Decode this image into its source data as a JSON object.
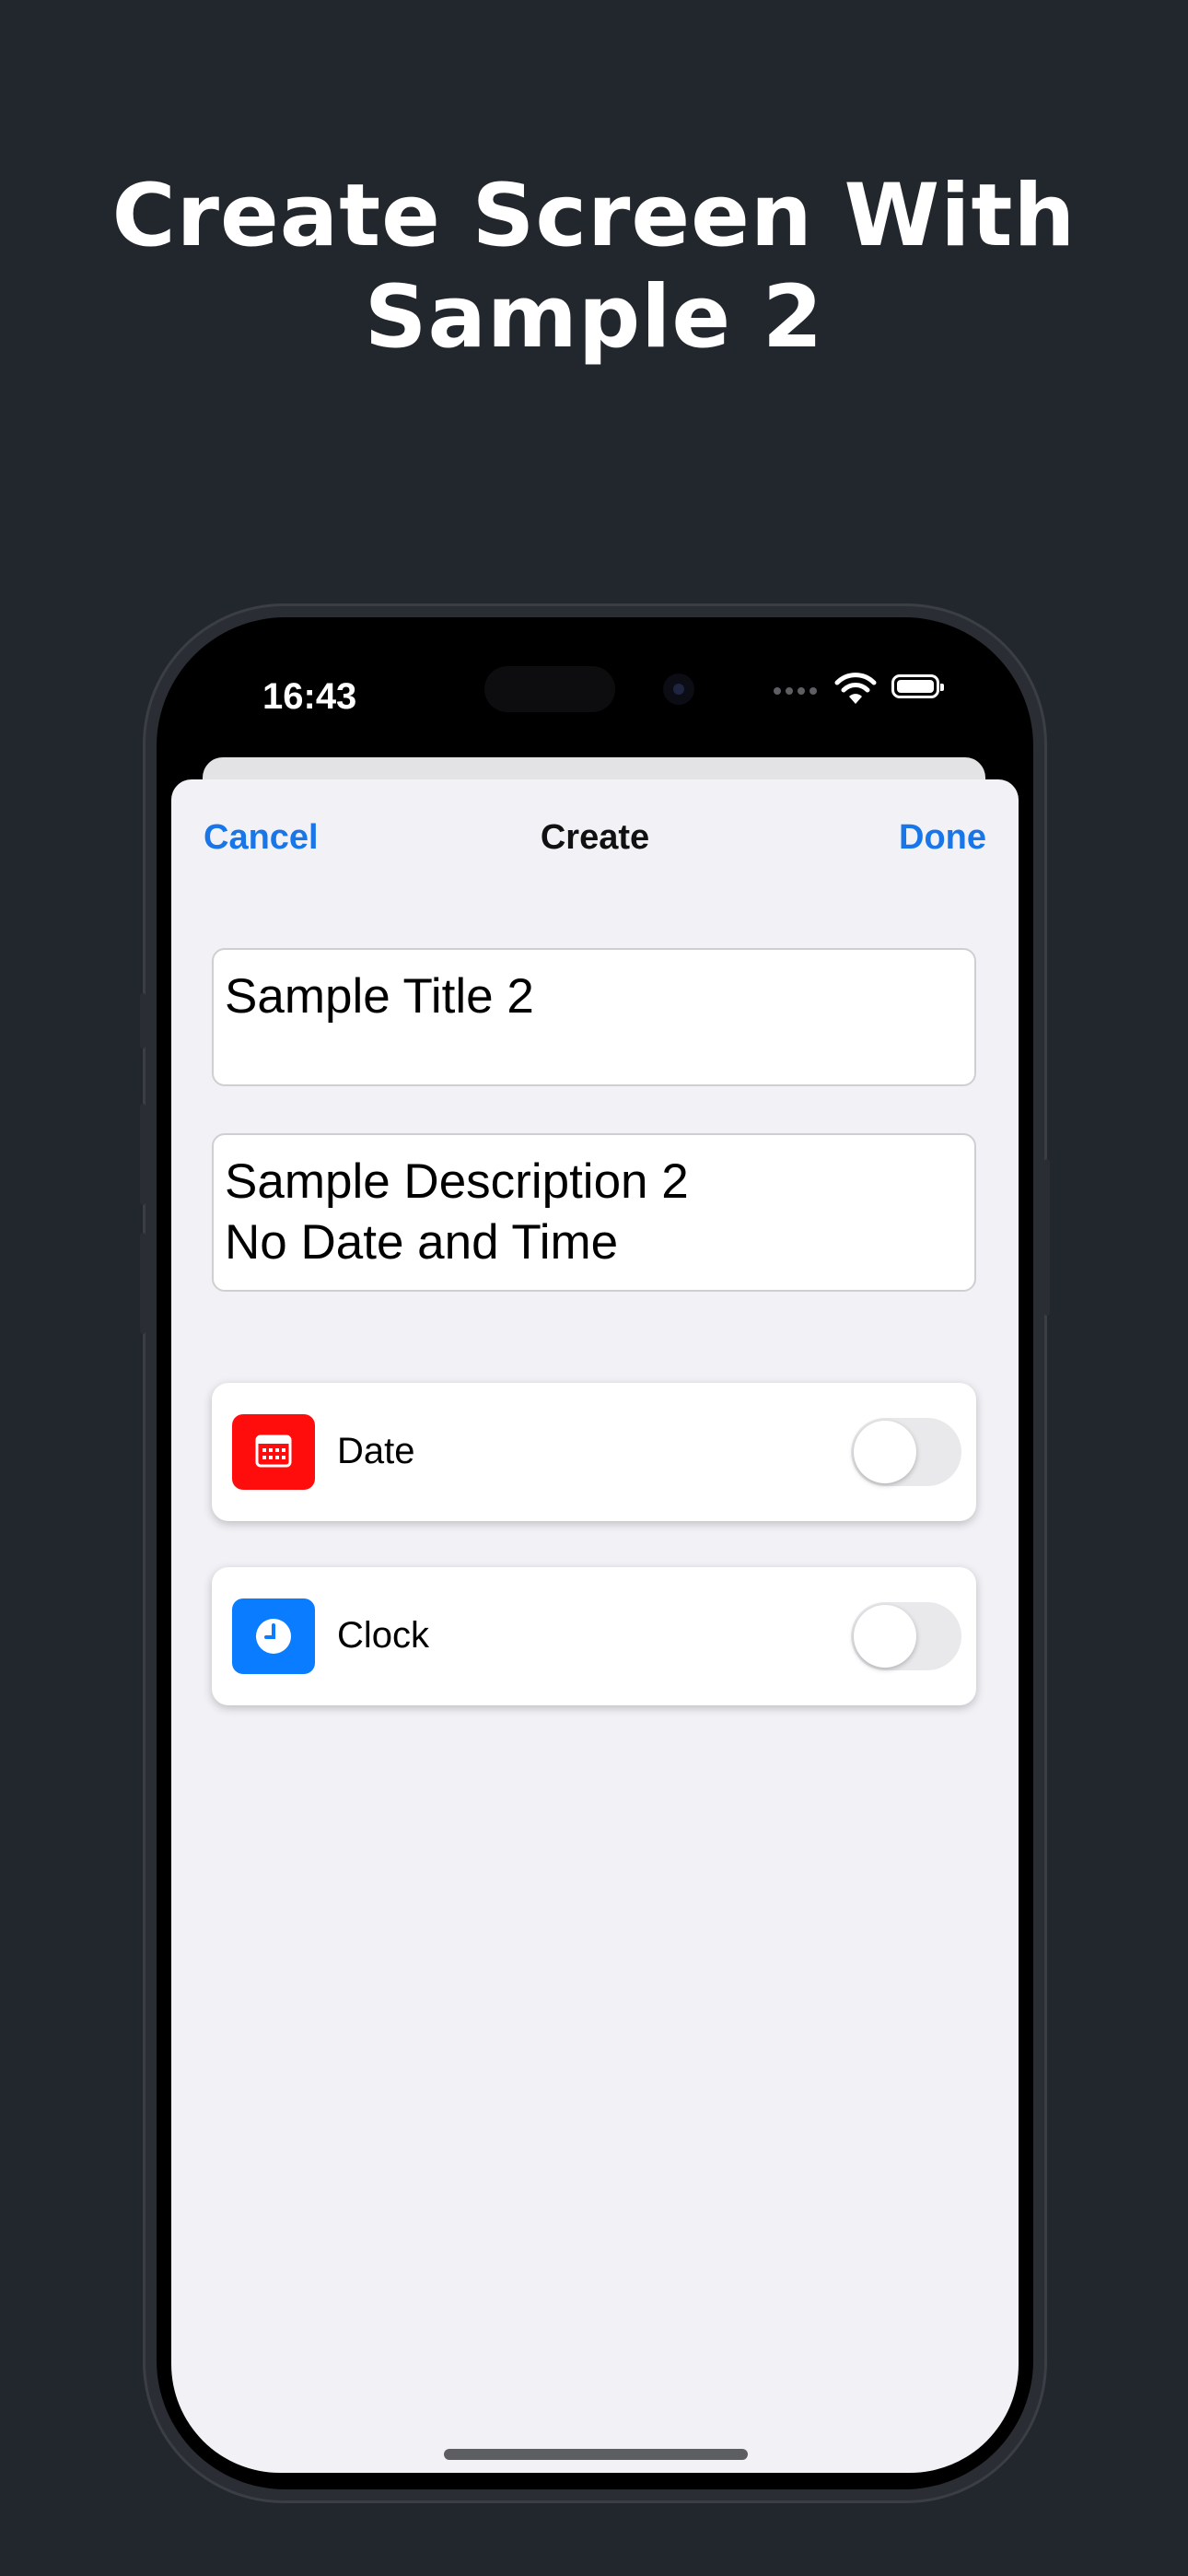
{
  "headline": {
    "line1": "Create Screen With",
    "line2": "Sample 2"
  },
  "status_bar": {
    "time": "16:43",
    "icons": [
      "signal-dots-icon",
      "wifi-icon",
      "battery-icon"
    ]
  },
  "nav": {
    "cancel_label": "Cancel",
    "title": "Create",
    "done_label": "Done"
  },
  "form": {
    "title_value": "Sample Title 2",
    "description_line1": "Sample Description 2",
    "description_line2": "No Date and Time"
  },
  "options": [
    {
      "label": "Date",
      "icon": "calendar-icon",
      "icon_color": "#ff0d0d",
      "enabled": false
    },
    {
      "label": "Clock",
      "icon": "clock-icon",
      "icon_color": "#0a7cff",
      "enabled": false
    }
  ],
  "colors": {
    "background": "#22262d",
    "accent": "#1976e8",
    "screen": "#f1f1f6"
  }
}
